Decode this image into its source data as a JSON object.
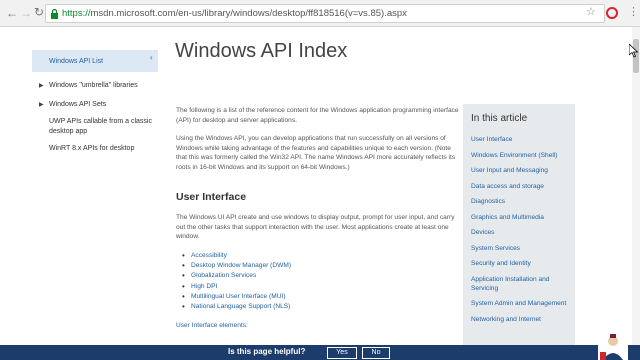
{
  "browser": {
    "url_scheme": "https://",
    "url_rest": "msdn.microsoft.com/en-us/library/windows/desktop/ff818516(v=vs.85).aspx"
  },
  "leftnav": {
    "items": [
      {
        "label": "Windows API List",
        "active": true
      },
      {
        "label": "Windows \"umbrella\" libraries",
        "expandable": true
      },
      {
        "label": "Windows API Sets",
        "expandable": true
      },
      {
        "label": "UWP APIs callable from a classic desktop app"
      },
      {
        "label": "WinRT 8.x APIs for desktop"
      }
    ]
  },
  "main": {
    "title": "Windows API Index",
    "intro": "The following is a list of the reference content for the Windows application programming interface (API) for desktop and server applications.",
    "para2": "Using the Windows API, you can develop applications that run successfully on all versions of Windows while taking advantage of the features and capabilities unique to each version. (Note that this was formerly called the Win32 API. The name Windows API more accurately reflects its roots in 16-bit Windows and its support on 64-bit Windows.)",
    "section_heading": "User Interface",
    "section_text": "The Windows UI API create and use windows to display output, prompt for user input, and carry out the other tasks that support interaction with the user. Most applications create at least one window.",
    "bullets": [
      "Accessibility",
      "Desktop Window Manager (DWM)",
      "Globalization Services",
      "High DPI",
      "Multilingual User Interface (MUI)",
      "National Language Support (NLS)"
    ],
    "ui_elements_link": "User Interface elements:"
  },
  "toc": {
    "title": "In this article",
    "links": [
      "User Interface",
      "Windows Environment (Shell)",
      "User Input and Messaging",
      "Data access and storage",
      "Diagnostics",
      "Graphics and Multimedia",
      "Devices",
      "System Services",
      "Security and Identity",
      "Application Installation and Servicing",
      "System Admin and Management",
      "Networking and Internet"
    ]
  },
  "feedback": {
    "question": "Is this page helpful?",
    "yes": "Yes",
    "no": "No"
  },
  "colors": {
    "link": "#1f5f9e",
    "feedback_bar": "#1c3c6c",
    "toc_bg": "#e7eaed",
    "active_nav_bg": "#dde8f5"
  }
}
